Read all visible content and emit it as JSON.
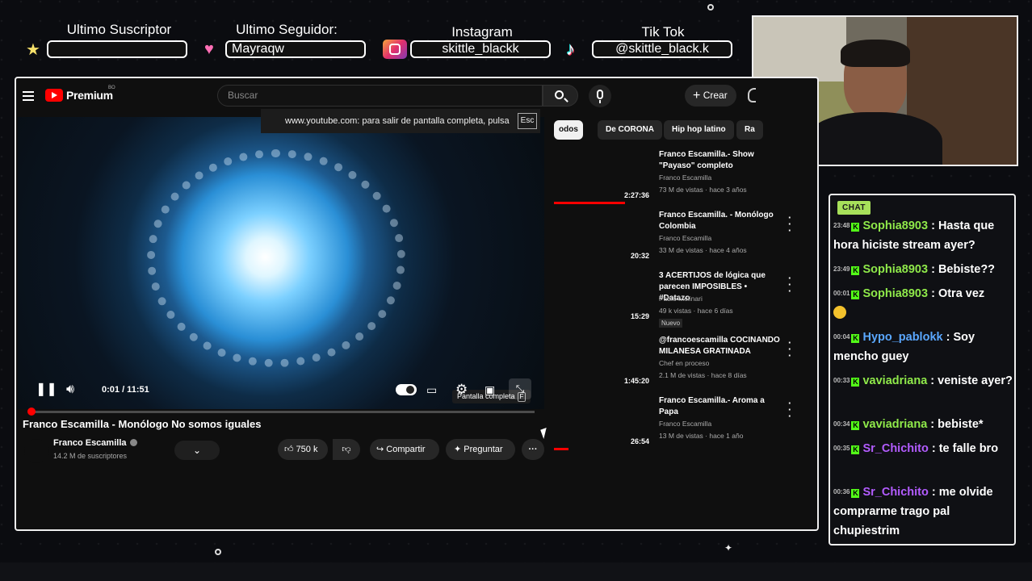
{
  "overlay": {
    "last_subscriber_label": "Ultimo Suscriptor",
    "last_subscriber_value": "",
    "last_follower_label": "Ultimo Seguidor:",
    "last_follower_value": "Mayraqw",
    "instagram_label": "Instagram",
    "instagram_value": "skittle_blackk",
    "tiktok_label": "Tik Tok",
    "tiktok_value": "@skittle_black.k"
  },
  "youtube": {
    "brand": "Premium",
    "brand_badge": "BO",
    "search_placeholder": "Buscar",
    "create_label": "Crear",
    "fullscreen_exit_tip": "www.youtube.com: para salir de pantalla completa, pulsa",
    "esc_key": "Esc",
    "player": {
      "time": "0:01 / 11:51",
      "progress_fraction": 0.002,
      "fullscreen_tip": "Pantalla completa",
      "fullscreen_key": "F"
    },
    "video_title": "Franco Escamilla - Monólogo No somos iguales",
    "channel": "Franco Escamilla",
    "subscribers": "14.2 M de suscriptores",
    "likes": "750 k",
    "share_label": "Compartir",
    "ask_label": "Preguntar",
    "chips": [
      "odos",
      "De CORONA",
      "Hip hop latino",
      "Ra"
    ],
    "related": [
      {
        "title": "Franco Escamilla.- Show \"Payaso\" completo",
        "channel": "Franco Escamilla",
        "meta": "73 M de vistas · hace 3 años",
        "duration": "2:27:36",
        "watched": 0.72,
        "new": ""
      },
      {
        "title": "Franco Escamilla. - Monólogo Colombia",
        "channel": "Franco Escamilla",
        "meta": "33 M de vistas · hace 4 años",
        "duration": "20:32",
        "watched": 0,
        "new": ""
      },
      {
        "title": "3 ACERTIJOS de lógica que parecen IMPOSIBLES • #Datazo",
        "channel": "Pablo Molinari",
        "meta": "49 k vistas · hace 6 días",
        "duration": "15:29",
        "watched": 0,
        "new": "Nuevo"
      },
      {
        "title": "@francoescamilla COCINANDO MILANESA GRATINADA",
        "channel": "Chef en proceso",
        "meta": "2.1 M de vistas · hace 8 días",
        "duration": "1:45:20",
        "watched": 0,
        "new": ""
      },
      {
        "title": "Franco Escamilla.- Aroma a Papa",
        "channel": "Franco Escamilla",
        "meta": "13 M de vistas · hace 1 año",
        "duration": "26:54",
        "watched": 0.15,
        "new": ""
      }
    ]
  },
  "chat": {
    "badge": "CHAT",
    "messages": [
      {
        "time": "23:48",
        "user": "Sophia8903",
        "text": " : Hasta que hora hiciste stream ayer?",
        "color": "#8fe94a"
      },
      {
        "time": "23:49",
        "user": "Sophia8903",
        "text": " : Bebiste??",
        "color": "#8fe94a"
      },
      {
        "time": "00:01",
        "user": "Sophia8903",
        "text": " : Otra vez",
        "color": "#8fe94a"
      },
      {
        "time": "00:04",
        "user": "Hypo_pablokk",
        "text": " : Soy mencho guey",
        "color": "#5aa7ff"
      },
      {
        "time": "00:33",
        "user": "vaviadriana",
        "text": " : veniste ayer?",
        "color": "#8fe94a"
      },
      {
        "time": "00:34",
        "user": "vaviadriana",
        "text": " : bebiste*",
        "color": "#8fe94a"
      },
      {
        "time": "00:35",
        "user": "Sr_Chichito",
        "text": " : te falle bro",
        "color": "#b35cff"
      },
      {
        "time": "00:36",
        "user": "Sr_Chichito",
        "text": " : me olvide comprarme trago pal chupiestrim",
        "color": "#b35cff"
      }
    ]
  }
}
